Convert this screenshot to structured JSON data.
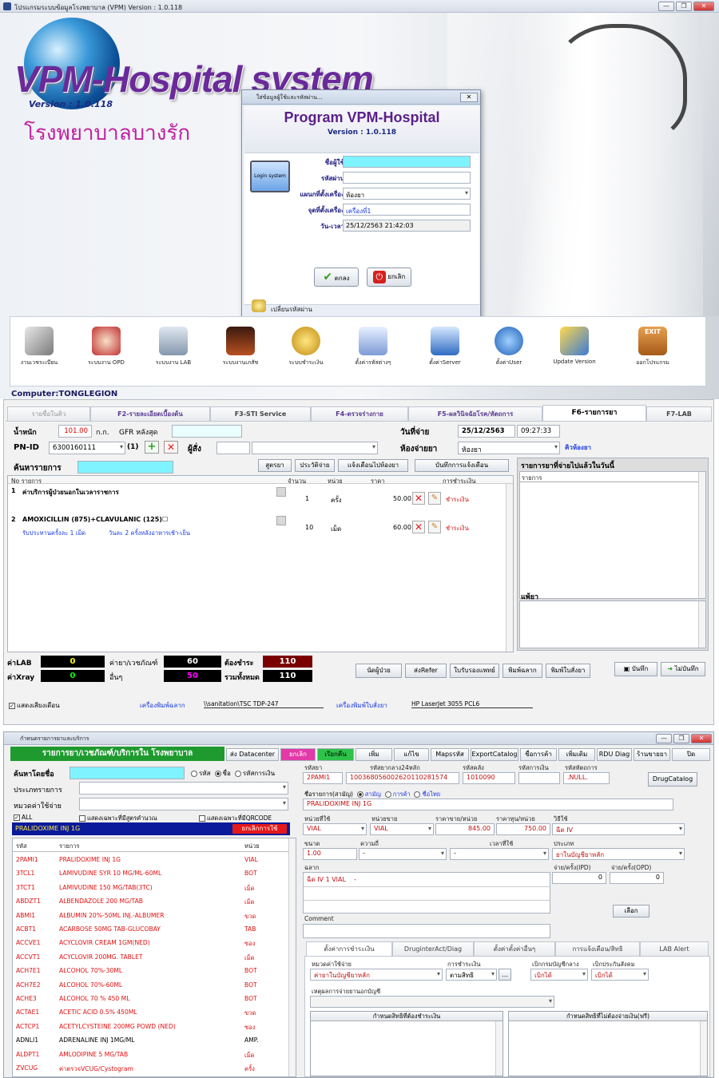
{
  "w1": {
    "title": "โปรแกรมระบบข้อมูลโรงพยาบาล (VPM) Version : 1.0.118",
    "brand": "VPM-Hospital system",
    "version": "Version : 1.0.118",
    "hospital": "โรงพยาบาลบางรัก",
    "computer": "Computer:TONGLEGION",
    "login": {
      "title": "ใส่ข้อมูลผู้ใช้และรหัสผ่าน...",
      "heading": "Program VPM-Hospital",
      "version": "Version : 1.0.118",
      "monitor_text": "Login system",
      "labels": {
        "user": "ชื่อผู้ใช้",
        "pass": "รหัสผ่าน",
        "dept": "แผนกที่ตั้งเครื่อง",
        "point": "จุดที่ตั้งเครื่อง",
        "datetime": "วัน-เวลา"
      },
      "values": {
        "user": "",
        "pass": "",
        "dept": "ห้องยา",
        "point": "เครื่องที่1",
        "datetime": "25/12/2563  21:42:03"
      },
      "ok": "ตกลง",
      "cancel": "ยกเลิก",
      "change_pass": "เปลี่ยนรหัสผ่าน"
    },
    "toolbar": [
      "งานเวชระเบียน",
      "ระบบงาน OPD",
      "ระบบงาน LAB",
      "ระบบงานเภสัช",
      "ระบบชำระเงิน",
      "ตั้งค่ารหัสต่างๆ",
      "ตั้งค่าServer",
      "ตั้งค่าUser",
      "Update Version",
      "ออกโปรแกรม"
    ],
    "exit_sign": "EXIT"
  },
  "w2": {
    "tabs": [
      "รายชื่อในคิว",
      "F2-รายละเอียดเบื้องต้น",
      "F3-STI Service",
      "F4-ตรวจร่างกาย",
      "F5-ผลวินิจฉัยโรค/หัตถการ",
      "F6-รายการยา",
      "F7-LAB"
    ],
    "weight_label": "น้ำหนัก",
    "weight": "101.00",
    "weight_unit": "ก.ก.",
    "gfr_label": "GFR หลังสุด",
    "gfr": "",
    "pnid_label": "PN-ID",
    "pnid": "6300160111",
    "pnid_count": "(1)",
    "orderer_label": "ผู้สั่ง",
    "pay_date_label": "วันที่จ่าย",
    "pay_date": "25/12/2563",
    "pay_time": "09:27:33",
    "pharm_label": "ห้องจ่ายยา",
    "pharm": "ห้องยา",
    "queue_link": "คิวห้องยา",
    "search_label": "ค้นหารายการ",
    "buttons": [
      "สูตรยา",
      "ประวัติจ่าย",
      "แจ้งเตือนไปห้องยา",
      "บันทึกการแจ้งเตือน"
    ],
    "headers": [
      "No รายการ",
      "จำนวน",
      "หน่วย",
      "ราคา",
      "การชำระเงิน"
    ],
    "items": [
      {
        "no": "1",
        "name": "ค่าบริการผู้ป่วยนอกในเวลาราชการ",
        "qty": "1",
        "unit": "ครั้ง",
        "price": "50.00",
        "pay": "ชำระเงิน",
        "usage": "",
        "usage2": ""
      },
      {
        "no": "2",
        "name": "AMOXICILLIN (875)+CLAVULANIC (125)☐",
        "qty": "10",
        "unit": "เม็ด",
        "price": "60.00",
        "pay": "ชำระเงิน",
        "usage": "รับประทานครั้งละ 1 เม็ด",
        "usage2": "วันละ 2 ครั้งหลังอาหารเช้า-เย็น"
      }
    ],
    "right_title": "รายการยาที่จ่ายไปแล้วในวันนี้",
    "right_header": "รายการ",
    "allergy_title": "แพ้ยา",
    "totals": {
      "lab_label": "ค่าLAB",
      "lab": "0",
      "xray_label": "ค่าXray",
      "xray": "0",
      "drug_label": "ค่ายา/เวชภัณฑ์",
      "drug": "60",
      "other_label": "อื่นๆ",
      "other": "50",
      "due_label": "ต้องชำระ",
      "due": "110",
      "total_label": "รวมทั้งหมด",
      "total": "110"
    },
    "bottom_buttons": [
      "นัดผู้ป่วย",
      "ส่งRefer",
      "ใบรับรองแพทย์",
      "พิมพ์ฉลาก",
      "พิมพ์ใบสั่งยา"
    ],
    "save": "บันทึก",
    "nosave": "ไม่บันทึก",
    "sound": "แสดงเสียงเตือน",
    "printer_label1": "เครื่องพิมพ์ฉลาก",
    "printer1": "\\\\sanitation\\TSC TDP-247",
    "printer_label2": "เครื่องพิมพ์ใบสั่งยา",
    "printer2": "HP LaserJet 3055 PCL6"
  },
  "w3": {
    "title": "กำหนดรายการยาและบริการ",
    "green_title": "รายการยา/เวชภัณฑ์/บริการใน โรงพยาบาล",
    "menu": [
      "ส่ง Datacenter",
      "ยกเลิก",
      "เรียกคืน",
      "เพิ่ม",
      "แก้ไข",
      "Mapsรหัส",
      "ExportCatalog",
      "ชื่อการค้า",
      "เพิ่มเติม",
      "RDU Diag",
      "ร้านขายยา",
      "ปิด"
    ],
    "search_label": "ค้นหาโดยชื่อ",
    "radio": [
      "รหัส",
      "ชื่อ",
      "รหัสการเงิน"
    ],
    "type_label": "ประเภทรายการ",
    "cat_label": "หมวดค่าใช้จ่าย",
    "all": "ALL",
    "only_formula": "แสดงเฉพาะที่มีสูตรคำนวณ",
    "only_qr": "แสดงเฉพาะที่มีQRCODE",
    "selected": "PRALIDOXIME INJ 1G",
    "cancel_use": "ยกเลิกการใช้",
    "list_headers": [
      "รหัส",
      "รายการ",
      "หน่วย"
    ],
    "list": [
      {
        "code": "2PAMI1",
        "name": "PRALIDOXIME INJ 1G",
        "unit": "VIAL",
        "red": true
      },
      {
        "code": "3TCL1",
        "name": "LAMIVUDINE SYR 10 MG/ML-60ML",
        "unit": "BOT",
        "red": true
      },
      {
        "code": "3TCT1",
        "name": "LAMIVUDINE 150 MG/TAB(3TC)",
        "unit": "เม็ด",
        "red": true
      },
      {
        "code": "ABDZT1",
        "name": "ALBENDAZOLE 200 MG/TAB",
        "unit": "เม็ด",
        "red": true
      },
      {
        "code": "ABMI1",
        "name": "ALBUMIN 20%-50ML INJ.-ALBUMER",
        "unit": "ขวด",
        "red": true
      },
      {
        "code": "ACBT1",
        "name": "ACARBOSE  50MG TAB-GLUCOBAY",
        "unit": "TAB",
        "red": true
      },
      {
        "code": "ACCVE1",
        "name": "ACYCLOVIR CREAM 1GM(NED)",
        "unit": "ซอง",
        "red": true
      },
      {
        "code": "ACCVT1",
        "name": "ACYCLOVIR  200MG. TABLET",
        "unit": "เม็ด",
        "red": true
      },
      {
        "code": "ACH7E1",
        "name": "ALCOHOL 70%-30ML",
        "unit": "BOT",
        "red": true
      },
      {
        "code": "ACH7E2",
        "name": "ALCOHOL 70%-60ML",
        "unit": "BOT",
        "red": true
      },
      {
        "code": "ACHE3",
        "name": "ALCOHOL 70 % 450 ML",
        "unit": "BOT",
        "red": true
      },
      {
        "code": "ACTAE1",
        "name": "ACETIC ACID 0.5% 450ML",
        "unit": "ขวด",
        "red": true
      },
      {
        "code": "ACTCP1",
        "name": "ACETYLCYSTEINE 200MG POWD (NED)",
        "unit": "ซอง",
        "red": true
      },
      {
        "code": "ADNLI1",
        "name": "ADRENALINE INJ 1MG/ML",
        "unit": "AMP.",
        "red": false
      },
      {
        "code": "ALDPT1",
        "name": "AMLODIPINE 5 MG/TAB",
        "unit": "เม็ด",
        "red": true
      },
      {
        "code": "ZVCUG",
        "name": "ค่าตรวจVCUG/Cystogram",
        "unit": "ครั้ง",
        "red": true
      }
    ],
    "form": {
      "code_label": "รหัสยา",
      "code": "2PAMI1",
      "tmt_label": "รหัสยากลาง24หลัก",
      "tmt": "100368056002620110281574",
      "stock_label": "รหัสคลัง",
      "stock": "1010090",
      "fin_label": "รหัสการเงิน",
      "fin": "",
      "proc_label": "รหัสหัตถการ",
      "proc": ".NULL.",
      "catalog": "DrugCatalog",
      "name_label": "ชื่อรายการ(สามัญ)",
      "name_opts": [
        "สามัญ",
        "การค้า",
        "ชื่อไทย"
      ],
      "name": "PRALIDOXIME INJ 1G",
      "use_unit_label": "หน่วยที่ใช้",
      "use_unit": "VIAL",
      "sell_unit_label": "หน่วยขาย",
      "sell_unit": "VIAL",
      "price_label": "ราคาขาย/หน่วย",
      "price": "845.00",
      "cost_label": "ราคาทุน/หน่วย",
      "cost": "750.00",
      "method_label": "วิธีใช้",
      "method": "ฉีด IV",
      "size_label": "ขนาด",
      "size": "1.00",
      "freq_label": "ความถี่",
      "freq": "-",
      "time_label": "เวลาที่ใช้",
      "time": "-",
      "type_label": "ประเภท",
      "type": "ยาในบัญชียาหลัก",
      "label_label": "ฉลาก",
      "label": "ฉีด IV 1 VIAL    -",
      "ipd_label": "จ่าย/ครั้ง(IPD)",
      "ipd": "0",
      "opd_label": "จ่าย/ครั้ง(OPD)",
      "opd": "0",
      "select": "เลือก",
      "comment_label": "Comment"
    },
    "subtabs": [
      "ตั้งค่าการชำระเงิน",
      "DruginterAct/Diag",
      "ตั้งค่าตั้งค่าอื่นๆ",
      "การแจ้งเตือน/สิทธิ",
      "LAB Alert"
    ],
    "pay": {
      "cat_label": "หมวดค่าใช้จ่าย",
      "cat": "ค่ายาในบัญชียาหลัก",
      "pay_label": "การชำระเงิน",
      "pay": "ตามสิทธิ",
      "claim_label": "เบิกกรมบัญชีกลาง",
      "claim": "เบิกได้",
      "social_label": "เบิกประกันสังคม",
      "social": "เบิกได้",
      "reason_label": "เหตุผลการจ่ายยานอกบัญชี",
      "paid_rights": "กำหนดสิทธิที่ต้องชำระเงิน",
      "free_rights": "กำหนดสิทธิที่ไม่ต้องจ่ายเงิน(ฟรี)"
    }
  }
}
